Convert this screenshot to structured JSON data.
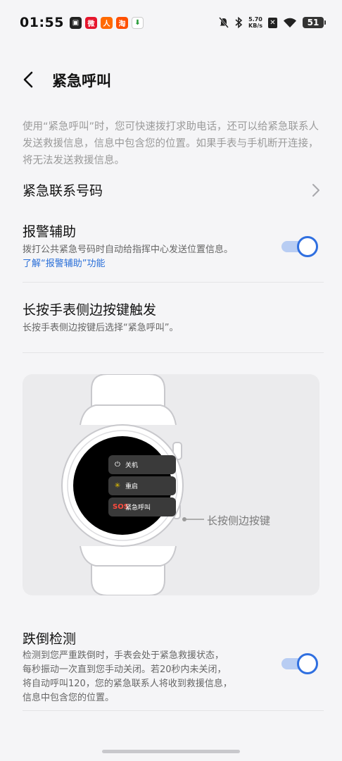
{
  "status_bar": {
    "time": "01:55",
    "net_speed_value": "5.70",
    "net_speed_unit": "KB/s",
    "battery": "51"
  },
  "header": {
    "title": "紧急呼叫"
  },
  "intro": "使用“紧急呼叫”时，您可快速拨打求助电话，还可以给紧急联系人发送救援信息，信息中包含您的位置。如果手表与手机断开连接，将无法发送救援信息。",
  "emergency_contacts": {
    "title": "紧急联系号码"
  },
  "alarm_assist": {
    "title": "报警辅助",
    "subtitle": "拨打公共紧急号码时自动给指挥中心发送位置信息。",
    "link": "了解“报警辅助”功能",
    "enabled": true
  },
  "side_button": {
    "title": "长按手表侧边按键触发",
    "subtitle": "长按手表侧边按键后选择“紧急呼叫”。"
  },
  "illustration": {
    "menu": [
      {
        "label": "关机",
        "icon": "power-icon"
      },
      {
        "label": "重启",
        "icon": "restart-icon"
      },
      {
        "label": "紧急呼叫",
        "icon": "sos-icon",
        "badge": "SOS"
      }
    ],
    "callout": "长按侧边按键"
  },
  "fall_detection": {
    "title": "跌倒检测",
    "lines": [
      "检测到您严重跌倒时，手表会处于紧急救援状态，",
      "每秒振动一次直到您手动关闭。若20秒内未关闭，",
      "将自动呼叫120，您的紧急联系人将收到救援信息，",
      "信息中包含您的位置。"
    ],
    "enabled": true
  },
  "colors": {
    "accent": "#2f6fe0",
    "toggle_track": "#b8cdf3",
    "link": "#2a6fd8",
    "background": "#f5f5f7"
  }
}
